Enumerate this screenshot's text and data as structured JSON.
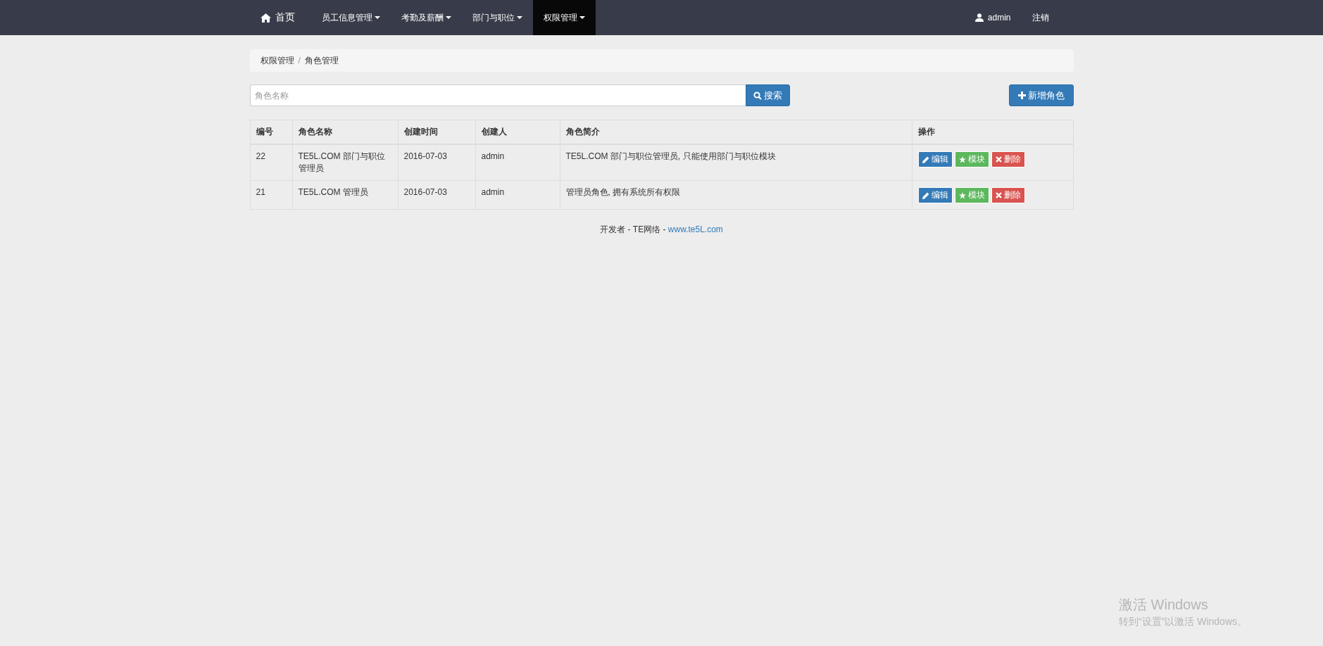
{
  "navbar": {
    "items": [
      {
        "kind": "home",
        "label": "首页",
        "selected": false
      },
      {
        "kind": "dropdown",
        "label": "员工信息管理",
        "selected": false
      },
      {
        "kind": "dropdown",
        "label": "考勤及薪酬",
        "selected": false
      },
      {
        "kind": "dropdown",
        "label": "部门与职位",
        "selected": false
      },
      {
        "kind": "dropdown",
        "label": "权限管理",
        "selected": true
      }
    ],
    "user": "admin",
    "logout": "注销"
  },
  "breadcrumb": [
    "权限管理",
    "角色管理"
  ],
  "breadcrumb_separator": "/",
  "search": {
    "placeholder": "角色名称",
    "button": "搜索"
  },
  "add_button": "新增角色",
  "table": {
    "columns": [
      "编号",
      "角色名称",
      "创建时间",
      "创建人",
      "角色简介",
      "操作"
    ],
    "rows": [
      {
        "cells": [
          "22",
          "TE5L.COM 部门与职位管理员",
          "2016-07-03",
          "admin",
          "TE5L.COM 部门与职位管理员, 只能使用部门与职位模块"
        ],
        "actions": [
          {
            "kind": "edit",
            "label": "编辑"
          },
          {
            "kind": "module",
            "label": "模块"
          },
          {
            "kind": "delete",
            "label": "删除"
          }
        ]
      },
      {
        "cells": [
          "21",
          "TE5L.COM 管理员",
          "2016-07-03",
          "admin",
          "管理员角色, 拥有系统所有权限"
        ],
        "actions": [
          {
            "kind": "edit",
            "label": "编辑"
          },
          {
            "kind": "module",
            "label": "模块"
          },
          {
            "kind": "delete",
            "label": "删除"
          }
        ]
      }
    ]
  },
  "footer": {
    "text": "开发者 - TE网络 - ",
    "link": "www.te5L.com"
  },
  "windows_activation": {
    "title": "激活 Windows",
    "subtitle": "转到“设置”以激活 Windows。"
  }
}
